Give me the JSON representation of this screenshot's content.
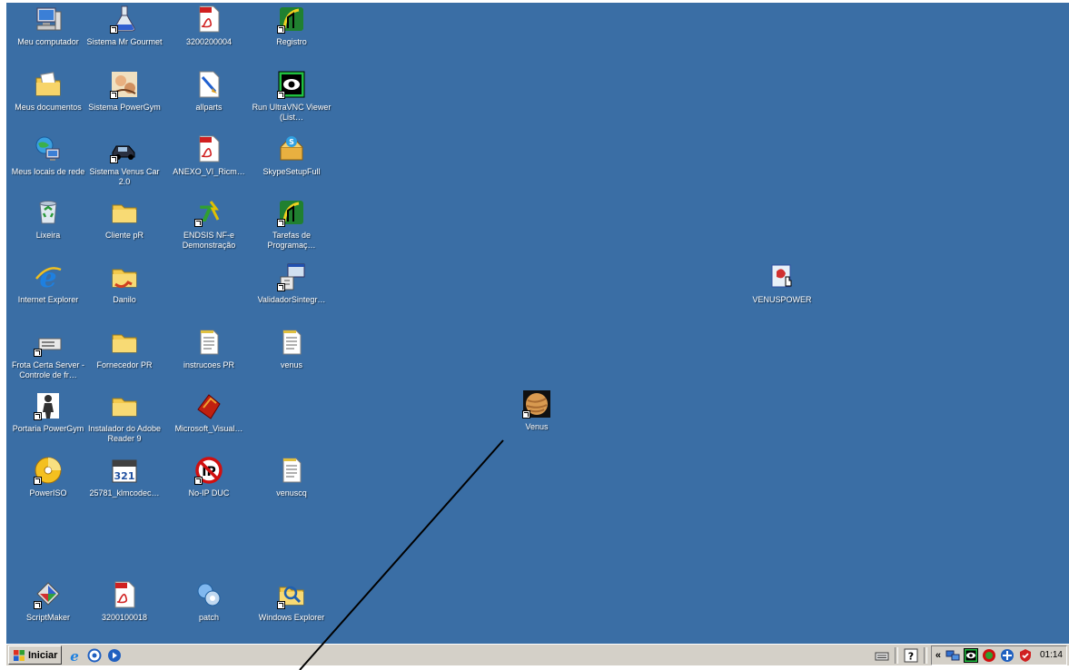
{
  "desktop": {
    "background_color": "#3a6ea5",
    "icons": [
      {
        "label": "Meu computador",
        "icon": "computer-icon"
      },
      {
        "label": "Sistema Mr Gourmet",
        "icon": "flask-icon"
      },
      {
        "label": "3200200004",
        "icon": "pdf-icon"
      },
      {
        "label": "Registro",
        "icon": "registry-app-icon"
      },
      {
        "label": "Meus documentos",
        "icon": "documents-folder-icon"
      },
      {
        "label": "Sistema PowerGym",
        "icon": "powergym-icon"
      },
      {
        "label": "allparts",
        "icon": "paint-document-icon"
      },
      {
        "label": "Run UltraVNC Viewer (List…",
        "icon": "ultravnc-eye-icon"
      },
      {
        "label": "Meus locais de rede",
        "icon": "network-places-icon"
      },
      {
        "label": "Sistema Venus Car 2.0",
        "icon": "car-icon"
      },
      {
        "label": "ANEXO_VI_Ricm…",
        "icon": "pdf-icon"
      },
      {
        "label": "SkypeSetupFull",
        "icon": "installer-box-icon"
      },
      {
        "label": "Lixeira",
        "icon": "recycle-bin-icon"
      },
      {
        "label": "Cliente pR",
        "icon": "folder-icon"
      },
      {
        "label": "ENDSIS NF-e Demonstração",
        "icon": "endsis-icon"
      },
      {
        "label": "Tarefas de Programaç…",
        "icon": "registry-app-icon"
      },
      {
        "label": "Internet Explorer",
        "icon": "internet-explorer-icon"
      },
      {
        "label": "Danilo",
        "icon": "shared-folder-icon"
      },
      {
        "label": "ValidadorSintegr…",
        "icon": "installer-window-icon"
      },
      {
        "label": "Frota Certa Server - Controle de fr…",
        "icon": "server-icon"
      },
      {
        "label": "Fornecedor PR",
        "icon": "folder-icon"
      },
      {
        "label": "instrucoes PR",
        "icon": "text-file-icon"
      },
      {
        "label": "venus",
        "icon": "text-file-icon"
      },
      {
        "label": "Portaria PowerGym",
        "icon": "person-icon"
      },
      {
        "label": "Instalador do Adobe Reader 9",
        "icon": "folder-icon"
      },
      {
        "label": "Microsoft_Visual…",
        "icon": "visual-studio-icon"
      },
      {
        "label": "PowerISO",
        "icon": "poweriso-disc-icon"
      },
      {
        "label": "25781_klmcodec…",
        "icon": "calendar-321-icon"
      },
      {
        "label": "No-IP DUC",
        "icon": "noip-icon"
      },
      {
        "label": "venuscq",
        "icon": "text-file-icon"
      },
      {
        "label": "ScriptMaker",
        "icon": "scriptmaker-icon"
      },
      {
        "label": "3200100018",
        "icon": "pdf-icon"
      },
      {
        "label": "patch",
        "icon": "patch-icon"
      },
      {
        "label": "Windows Explorer",
        "icon": "explorer-folder-icon"
      },
      {
        "label": "VENUSPOWER",
        "icon": "venuspower-icon"
      },
      {
        "label": "Venus",
        "icon": "venus-planet-icon"
      }
    ]
  },
  "taskbar": {
    "start_label": "Iniciar",
    "quick_launch": [
      "internet-explorer-icon",
      "outlook-icon",
      "media-player-icon"
    ],
    "tray_left": [
      "keyboard-icon",
      "help-icon"
    ],
    "tray_toggle": "«",
    "tray_icons": [
      "network-icon",
      "ultravnc-eye-icon",
      "noip-tray-icon",
      "antivirus-icon",
      "security-shield-icon"
    ],
    "clock": "01:14"
  }
}
